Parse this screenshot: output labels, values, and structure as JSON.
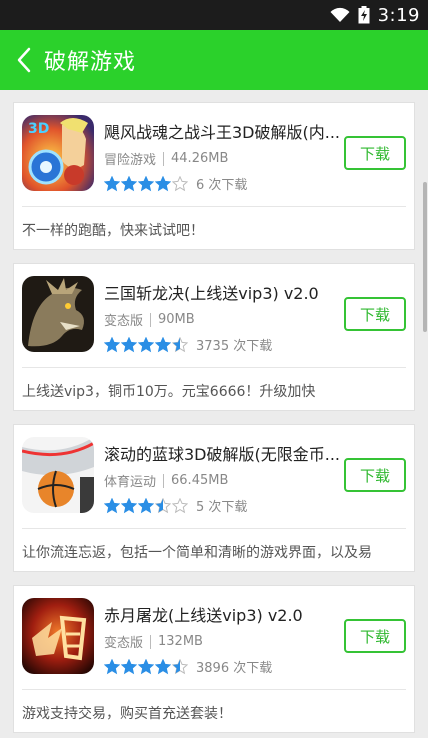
{
  "status_bar": {
    "time": "3:19"
  },
  "header": {
    "title": "破解游戏"
  },
  "colors": {
    "accent": "#2bd12b",
    "star": "#2a8ee5",
    "button_green": "#2fb82f"
  },
  "apps": [
    {
      "name": "飓风战魂之战斗王3D破解版(内...",
      "category": "冒险游戏",
      "size": "44.26MB",
      "rating": 4,
      "downloads": "6 次下载",
      "download_label": "下载",
      "description": "不一样的跑酷，快来试试吧！",
      "icon": "hurricane-warrior-app-icon"
    },
    {
      "name": "三国斩龙决(上线送vip3) v2.0",
      "category": "变态版",
      "size": "90MB",
      "rating": 4.5,
      "downloads": "3735 次下载",
      "download_label": "下载",
      "description": "上线送vip3，铜币10万。元宝6666！升级加快",
      "icon": "dragon-app-icon"
    },
    {
      "name": "滚动的蓝球3D破解版(无限金币...",
      "category": "体育运动",
      "size": "66.45MB",
      "rating": 3.5,
      "downloads": "5 次下载",
      "download_label": "下载",
      "description": "让你流连忘返，包括一个简单和清晰的游戏界面，以及易",
      "icon": "basketball-app-icon"
    },
    {
      "name": "赤月屠龙(上线送vip3) v2.0",
      "category": "变态版",
      "size": "132MB",
      "rating": 4.5,
      "downloads": "3896 次下载",
      "download_label": "下载",
      "description": "游戏支持交易，购买首充送套装！",
      "icon": "red-moon-app-icon"
    }
  ]
}
